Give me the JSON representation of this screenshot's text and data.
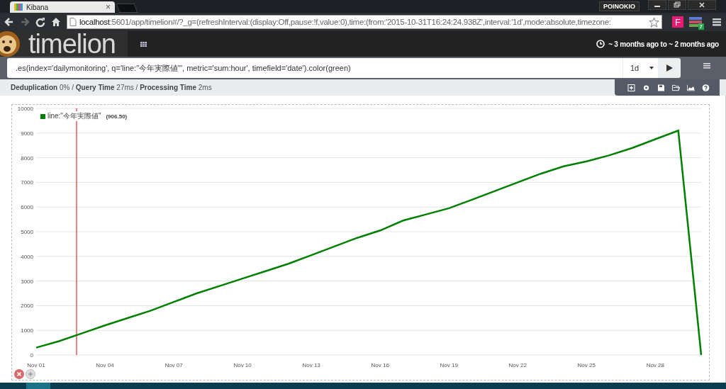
{
  "browser": {
    "tab": {
      "title": "Kibana",
      "close": "×",
      "selected": true
    },
    "profile": "POINOKIO",
    "url_host": "localhost",
    "url_rest": ":5601/app/timelion#/?_g=(refreshInterval:(display:Off,pause:!f,value:0),time:(from:'2015-10-31T16:24:24.938Z',interval:'1d',mode:absolute,timezone:",
    "extensions": [
      {
        "label": "F"
      },
      {
        "badge": "7"
      }
    ]
  },
  "app": {
    "name": "timelion",
    "time_range": "~ 3 months ago to ~ 2 months ago"
  },
  "query": {
    "expression": ".es(index='dailymonitoring', q='line:\"今年実際値\"', metric='sum:hour', timefield='date').color(green)",
    "interval": "1d"
  },
  "stats": "**Deduplication** 0% / **Query Time** 27ms / **Processing Time** 2ms",
  "chart": {
    "legend_values": [
      "(906.50)"
    ],
    "chart_data": {
      "type": "line",
      "categories": [
        "Nov 01",
        null,
        null,
        "Nov 04",
        null,
        null,
        "Nov 07",
        null,
        null,
        "Nov 10",
        null,
        null,
        "Nov 13",
        null,
        null,
        "Nov 16",
        null,
        null,
        "Nov 19",
        null,
        null,
        "Nov 22",
        null,
        null,
        "Nov 25",
        null,
        null,
        "Nov 28",
        null,
        null
      ],
      "series": [
        {
          "name": "line:\"今年実際値\"",
          "color": "#008000",
          "values": [
            300,
            560,
            880,
            1200,
            1500,
            1800,
            2150,
            2500,
            2800,
            3100,
            3400,
            3700,
            4050,
            4400,
            4750,
            5050,
            5450,
            5700,
            5950,
            6300,
            6650,
            7000,
            7350,
            7650,
            7850,
            8100,
            8400,
            8750,
            9100,
            0
          ]
        }
      ],
      "ylim": [
        0,
        10000
      ],
      "grid": true,
      "yticks": [
        0,
        1000,
        2000,
        3000,
        4000,
        5000,
        6000,
        7000,
        8000,
        9000,
        10000
      ]
    }
  }
}
